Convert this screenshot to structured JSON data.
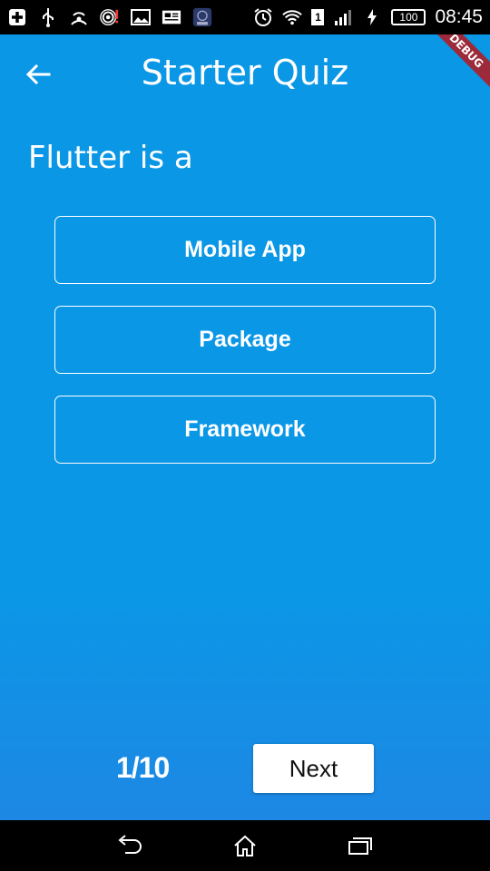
{
  "status_bar": {
    "time": "08:45",
    "battery": "100",
    "sim": "1",
    "icons": [
      "health-plus-icon",
      "usb-icon",
      "wifi-hotspot-icon",
      "nfc-alert-icon",
      "image-icon",
      "news-icon",
      "app-badge-icon",
      "alarm-icon",
      "wifi-icon",
      "signal-icon",
      "charging-icon"
    ]
  },
  "app_bar": {
    "title": "Starter Quiz",
    "back_icon": "arrow-left-icon"
  },
  "debug_banner": "DEBUG",
  "quiz": {
    "question": "Flutter is a",
    "options": [
      "Mobile App",
      "Package",
      "Framework"
    ],
    "counter": "1/10",
    "next_label": "Next"
  },
  "colors": {
    "background_top": "#0a97e6",
    "background_bottom": "#1d88e4",
    "debug_banner": "#9c2a3a"
  },
  "nav_bar": {
    "icons": [
      "back-icon",
      "home-icon",
      "recent-apps-icon"
    ]
  }
}
